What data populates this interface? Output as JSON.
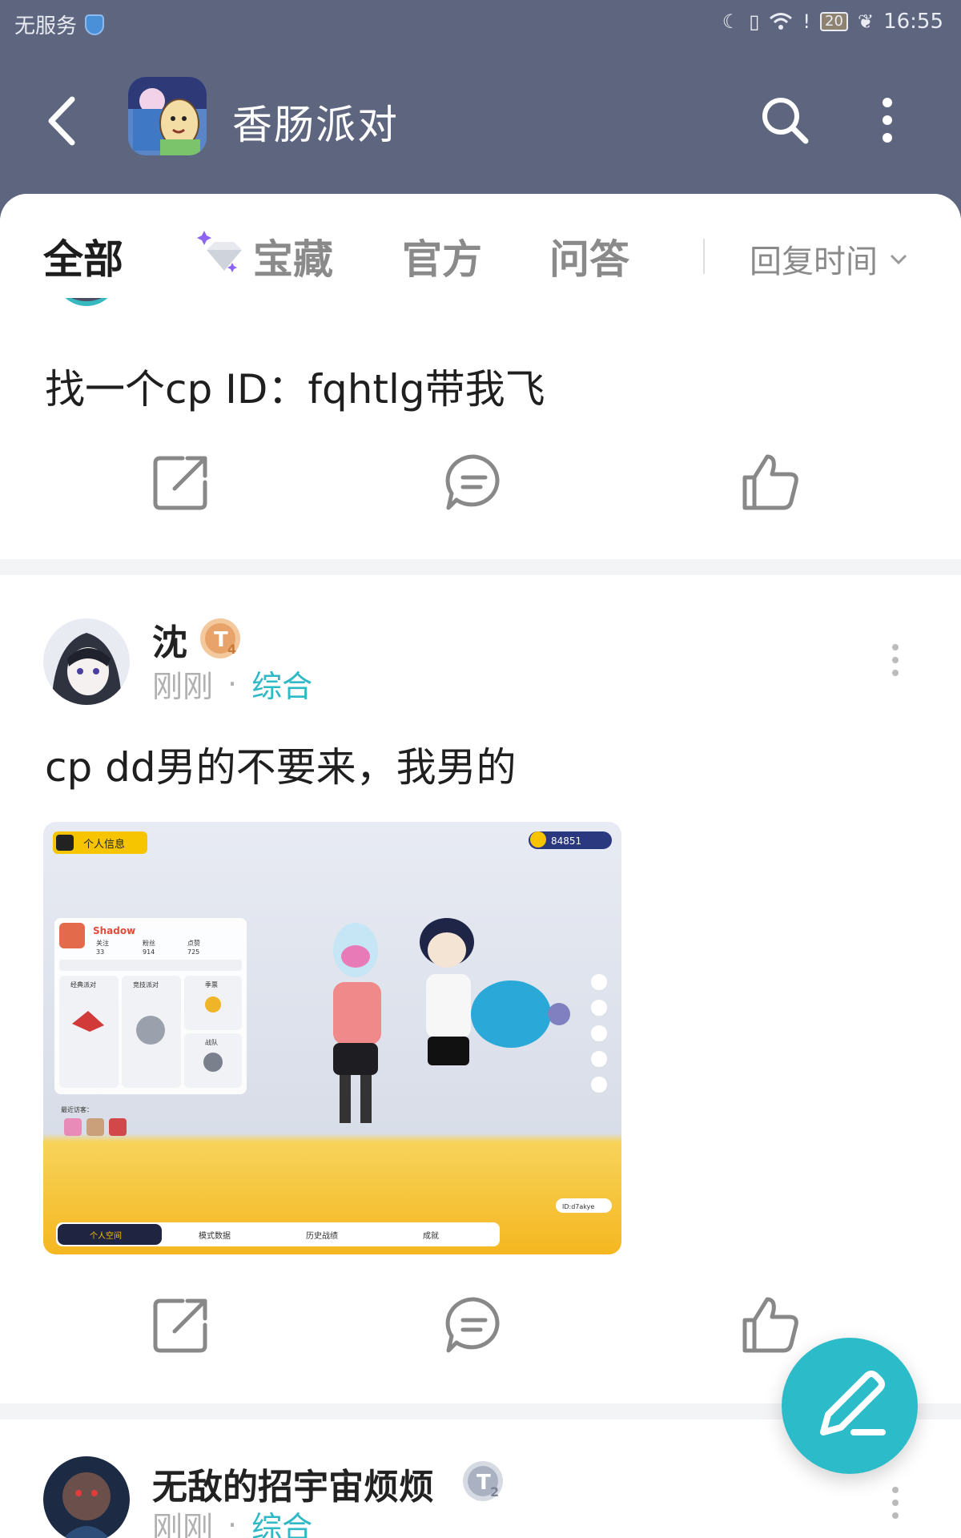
{
  "status_bar": {
    "carrier": "无服务",
    "battery": "20",
    "time": "16:55"
  },
  "header": {
    "title": "香肠派对"
  },
  "tabs": [
    {
      "label": "全部",
      "active": true
    },
    {
      "label": "宝藏",
      "active": false
    },
    {
      "label": "官方",
      "active": false
    },
    {
      "label": "问答",
      "active": false
    }
  ],
  "sort": {
    "label": "回复时间"
  },
  "posts": [
    {
      "partial": true,
      "text": "找一个cp ID：fqhtlg带我飞"
    },
    {
      "username": "沈",
      "level_badge": "T4",
      "time": "刚刚",
      "category": "综合",
      "text": "cp dd男的不要来，我男的",
      "screenshot": {
        "top_left_label": "个人信息",
        "currency": "84851",
        "player_name": "Shadow",
        "stats": [
          "关注",
          "粉丝",
          "点赞"
        ],
        "stat_values": [
          "33",
          "914",
          "725"
        ],
        "modes": [
          "经典派对",
          "竞技派对",
          "季票",
          "战队"
        ],
        "bottom_tabs": [
          "个人空间",
          "模式数据",
          "历史战绩",
          "成就"
        ],
        "recent_visitors": "最近访客：",
        "id_label": "ID:d7akye"
      }
    },
    {
      "username": "无敌的招宇宙烦烦",
      "level_badge": "T2",
      "time": "刚刚",
      "category": "综合"
    }
  ],
  "accent_color": "#2cbcc9"
}
